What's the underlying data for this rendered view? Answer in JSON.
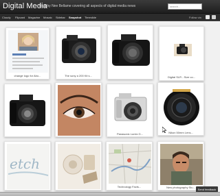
{
  "site": {
    "title": "Digital Media",
    "tagline": "Blog by Nee Bellame covering all aspects of digital media news",
    "search_placeholder": "search..."
  },
  "nav": {
    "items": [
      "Cloudy",
      "Flipcard",
      "Magazine",
      "Mosaic",
      "Sidebar",
      "Snapshot",
      "Timeslide"
    ],
    "active_index": 5,
    "follow_label": "Follow via"
  },
  "cards": [
    {
      "caption": "change logo for Abo..."
    },
    {
      "caption": "The sony a 200 Kit s..."
    },
    {
      "caption": ""
    },
    {
      "caption": "Digital SLR - Size co..."
    },
    {
      "caption": ""
    },
    {
      "caption": ""
    },
    {
      "caption": "Panasonic Lumix G..."
    },
    {
      "caption": "Nikon 50mm Lens..."
    },
    {
      "caption": ""
    },
    {
      "caption": ""
    },
    {
      "caption": "Technology Facts..."
    },
    {
      "caption": "New photography Stu..."
    }
  ],
  "feedback_button": "Send feedback",
  "colors": {
    "header_bg": "#2a2a2a",
    "nav_bg": "#2b2b2b",
    "page_bg": "#f1f1f1",
    "card_bg": "#ffffff"
  }
}
